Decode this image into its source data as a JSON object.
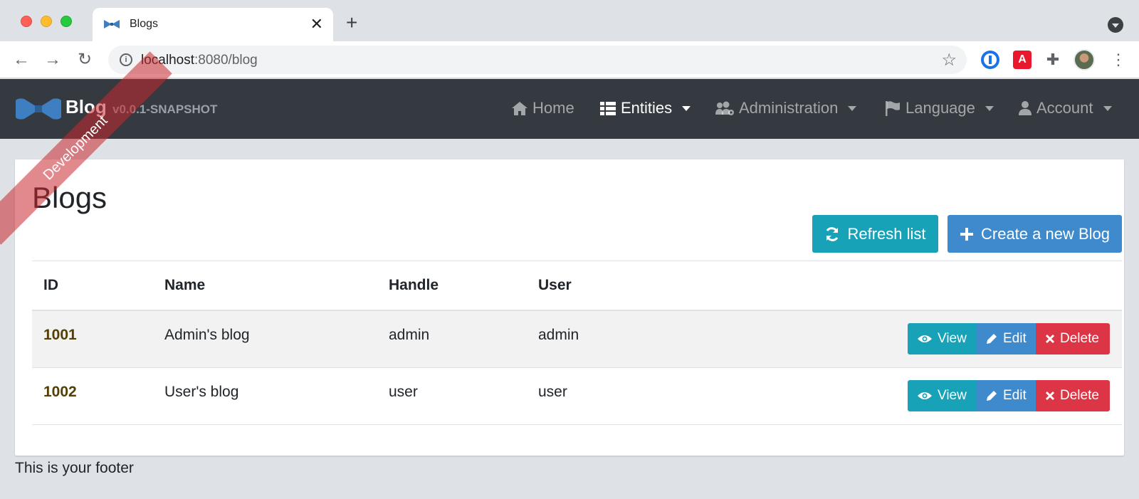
{
  "browser": {
    "tab_title": "Blogs",
    "tab_close": "✕",
    "new_tab": "+",
    "url_host": "localhost",
    "url_rest": ":8080/blog",
    "back": "←",
    "forward": "→",
    "reload": "↻",
    "star": "☆",
    "menu": "⋮",
    "ext_red_label": "A"
  },
  "navbar": {
    "brand_title": "Blog",
    "brand_version": "v0.0.1-SNAPSHOT",
    "items": [
      {
        "label": "Home",
        "icon": "home-icon",
        "active": false,
        "dropdown": false
      },
      {
        "label": "Entities",
        "icon": "table-list-icon",
        "active": true,
        "dropdown": true
      },
      {
        "label": "Administration",
        "icon": "users-cog-icon",
        "active": false,
        "dropdown": true
      },
      {
        "label": "Language",
        "icon": "flag-icon",
        "active": false,
        "dropdown": true
      },
      {
        "label": "Account",
        "icon": "user-icon",
        "active": false,
        "dropdown": true
      }
    ]
  },
  "ribbon": "Development",
  "page": {
    "title": "Blogs",
    "refresh_label": "Refresh list",
    "create_label": "Create a new Blog"
  },
  "table": {
    "headers": [
      "ID",
      "Name",
      "Handle",
      "User"
    ],
    "rows": [
      {
        "id": "1001",
        "name": "Admin's blog",
        "handle": "admin",
        "user": "admin"
      },
      {
        "id": "1002",
        "name": "User's blog",
        "handle": "user",
        "user": "user"
      }
    ],
    "actions": {
      "view": "View",
      "edit": "Edit",
      "delete": "Delete"
    }
  },
  "footer": "This is your footer",
  "colors": {
    "navbar": "#343a40",
    "info": "#17a2b8",
    "primary": "#3e8acc",
    "danger": "#dc3545",
    "id_link": "#533f03"
  }
}
